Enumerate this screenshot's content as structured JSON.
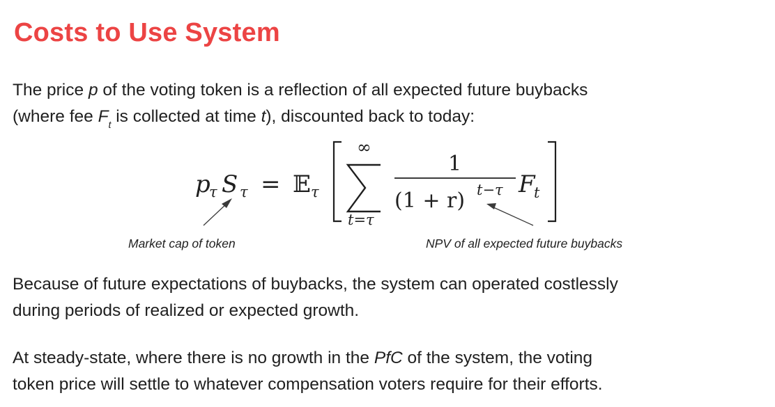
{
  "slide": {
    "title": "Costs to Use System",
    "para1": {
      "l1_a": "The price ",
      "l1_var": "p",
      "l1_b": " of the voting token is a reflection of all expected future buybacks",
      "l2_a": "(where fee ",
      "l2_var": "F",
      "l2_sub": "t",
      "l2_b": " is collected at time ",
      "l2_var2": "t",
      "l2_c": "), discounted back to today:"
    },
    "equation": {
      "lhs_p": "p",
      "lhs_S": "S",
      "tau": "τ",
      "equals": "=",
      "expectation": "𝔼",
      "sum_upper": "∞",
      "sum_lower": "t=τ",
      "numerator": "1",
      "denominator": "(1 + r)",
      "exponent": "t−τ",
      "rhs_F": "F",
      "rhs_sub": "t"
    },
    "annotations": {
      "left": "Market cap of token",
      "right": "NPV of all expected future buybacks"
    },
    "para2": {
      "l1": "Because of future expectations of buybacks, the system can operated costlessly",
      "l2": "during periods of realized or expected growth."
    },
    "para3": {
      "l1_a": "At steady-state, where there is no growth in the ",
      "l1_var": "PfC",
      "l1_b": " of the system, the voting",
      "l2": "token price will settle to whatever compensation voters require for their efforts."
    }
  }
}
